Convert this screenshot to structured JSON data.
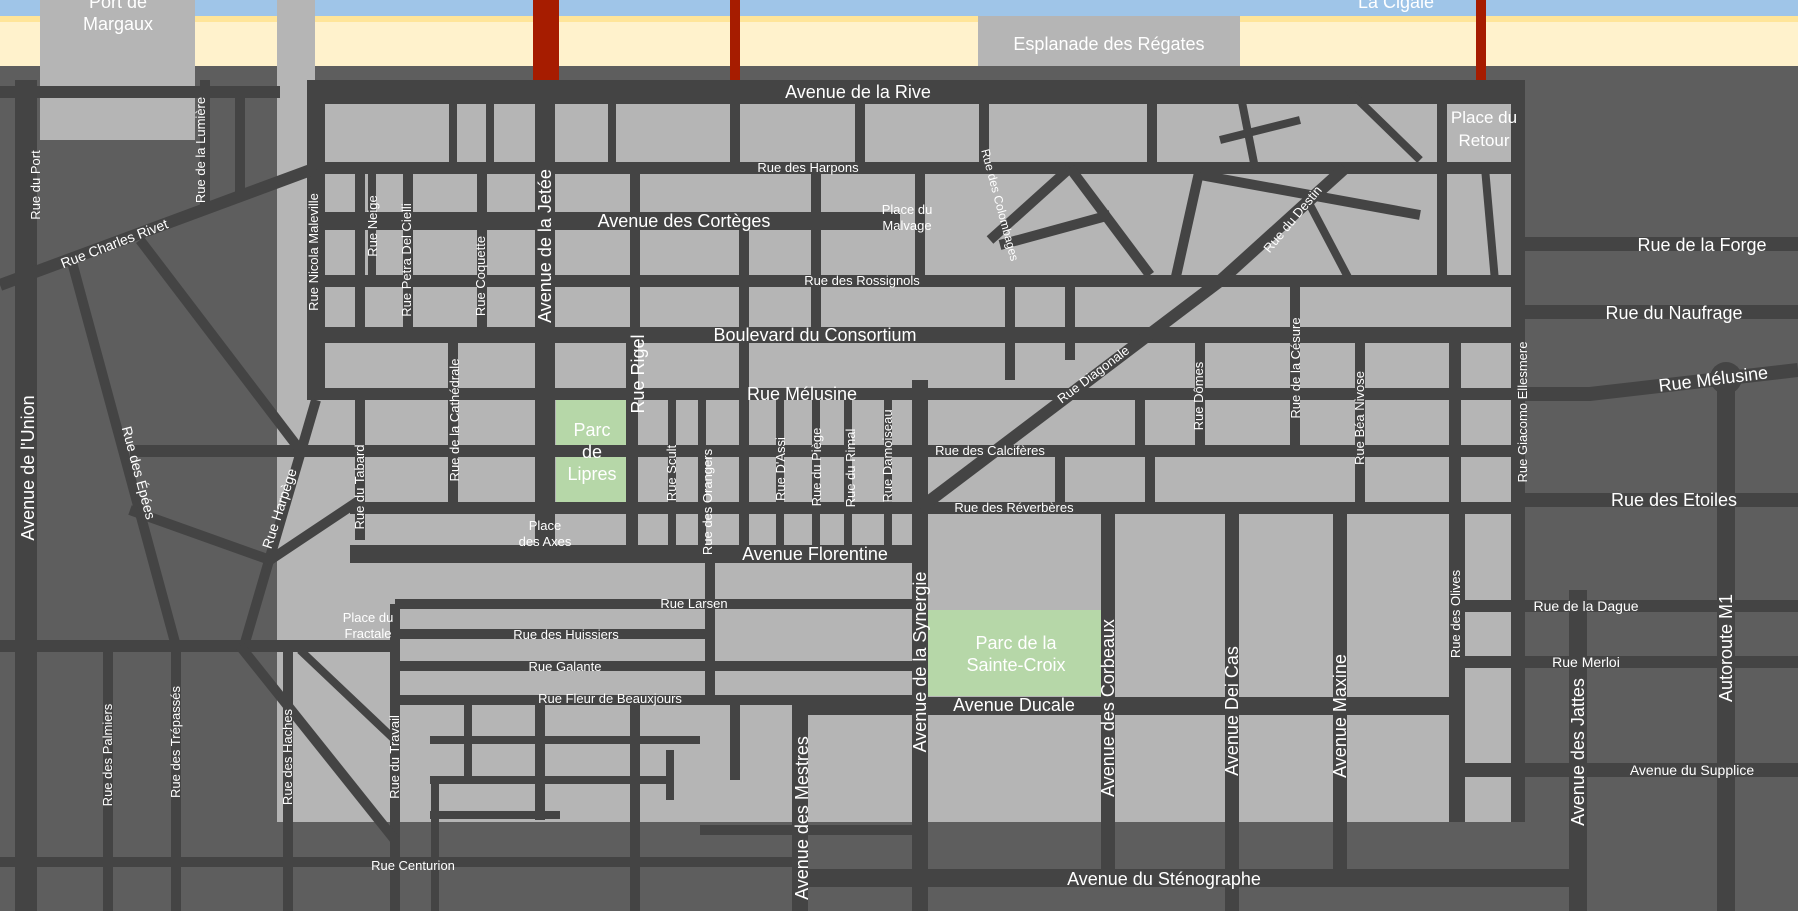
{
  "colors": {
    "outer_ground": "#5e5e5e",
    "city_block": "#b5b5b5",
    "road": "#444444",
    "park": "#b6d7a8",
    "beach": "#fff2cc",
    "beach_edge": "#ffe599",
    "water": "#9fc5e8",
    "pier": "#a61c00",
    "label": "#ffffff"
  },
  "places": {
    "port": "Port de\nMargaux",
    "la_cigale": "La Cigale",
    "esplanade": "Esplanade des Régates",
    "place_retour": "Place du\nRetour",
    "place_malvage": "Place du\nMalvage",
    "place_axes": "Place\ndes Axes",
    "place_fractale": "Place du\nFractale",
    "parc_lipres": "Parc\nde\nLipres",
    "parc_sainte_croix": "Parc de la\nSainte-Croix"
  },
  "streets": {
    "av_rive": "Avenue de la Rive",
    "rue_harpons": "Rue des Harpons",
    "av_corteges": "Avenue des Cortèges",
    "rue_rossignols": "Rue des Rossignols",
    "bd_consortium": "Boulevard du Consortium",
    "rue_melusine": "Rue Mélusine",
    "rue_melusine_east": "Rue Mélusine",
    "rue_calciferes": "Rue des Calcifères",
    "rue_reverberes": "Rue des Réverbères",
    "av_florentine": "Avenue Florentine",
    "rue_larsen": "Rue Larsen",
    "rue_huissiers": "Rue des Huissiers",
    "rue_galante": "Rue Galante",
    "rue_fleur": "Rue Fleur de Beauxjours",
    "av_ducale": "Avenue Ducale",
    "rue_centurion": "Rue Centurion",
    "av_stenographe": "Avenue du Sténographe",
    "rue_forge": "Rue de la Forge",
    "rue_naufrage": "Rue du Naufrage",
    "rue_etoiles": "Rue des Etoiles",
    "rue_dague": "Rue de la Dague",
    "rue_merloi": "Rue Merloi",
    "av_supplice": "Avenue du Supplice",
    "rue_charles_rivet": "Rue Charles Rivet",
    "rue_du_port": "Rue  du Port",
    "rue_lumiere": "Rue  de la Lumière",
    "av_union": "Avenue de l'Union",
    "rue_epees": "Rue des Épées",
    "rue_harpege": "Rue  Harpège",
    "rue_palmiers": "Rue des Palmiers",
    "rue_trepasses": "Rue des Trépassés",
    "rue_haches": "Rue des Haches",
    "rue_travail": "Rue du Travail",
    "rue_tabard": "Rue du Tabard",
    "rue_maleville": "Rue  Nicola Maleville",
    "rue_neige": "Rue Neige",
    "rue_petra": "Rue Petra Del Cielli",
    "rue_coquette": "Rue Coquette",
    "av_jetee": "Avenue de la Jetée",
    "rue_cathedrale": "Rue de la Cathédrale",
    "rue_rigel": "Rue Rigel",
    "rue_scult": "Rue Scult",
    "rue_orangers": "Rue des Orangers",
    "rue_dassi": "Rue D'Assi",
    "rue_piege": "Rue du Piège",
    "rue_rimal": "Rue du Rimal",
    "rue_damoiseau": "Rue Damoiseau",
    "rue_colombages": "Rue des Colombages",
    "rue_destin": "Rue du Destin",
    "rue_diagonale": "Rue Diagonale",
    "rue_domes": "Rue Dômes",
    "rue_cesure": "Rue de la Césure",
    "rue_bea": "Rue Béa Nivose",
    "rue_giacomo": "Rue Giacomo Ellesmere",
    "av_synergie": "Avenue de la Synergie",
    "av_mestres": "Avenue des Mestres",
    "av_corbeaux": "Avenue des Corbeaux",
    "av_dei_cas": "Avenue Dei Cas",
    "av_maxine": "Avenue Maxine",
    "rue_olives": "Rue des Olives",
    "av_jattes": "Avenue des Jattes",
    "autoroute": "Autoroute M1"
  }
}
